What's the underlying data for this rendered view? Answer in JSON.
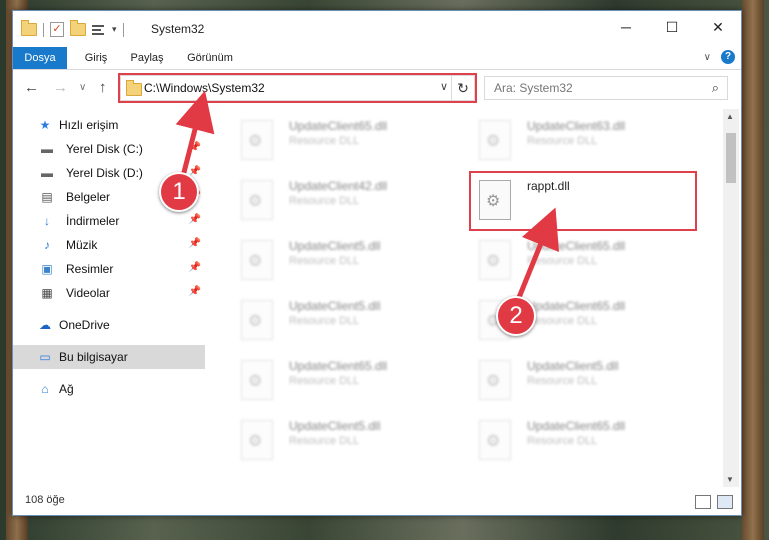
{
  "window": {
    "title": "System32",
    "controls": {
      "minimize": "─",
      "maximize": "☐",
      "close": "✕"
    }
  },
  "ribbon": {
    "tabs": [
      "Dosya",
      "Giriş",
      "Paylaş",
      "Görünüm"
    ],
    "collapse": "∨",
    "help": "?"
  },
  "nav": {
    "back": "←",
    "forward": "→",
    "recent": "∨",
    "up": "↑",
    "address": "C:\\Windows\\System32",
    "address_dropdown": "∨",
    "refresh": "↻",
    "search_placeholder": "Ara: System32",
    "search_icon": "⌕"
  },
  "sidebar": {
    "items": [
      {
        "label": "Hızlı erişim",
        "icon": "★"
      },
      {
        "label": "Yerel Disk (C:)",
        "icon": "▬"
      },
      {
        "label": "Yerel Disk (D:)",
        "icon": "▬"
      },
      {
        "label": "Belgeler",
        "icon": "▤"
      },
      {
        "label": "İndirmeler",
        "icon": "↓"
      },
      {
        "label": "Müzik",
        "icon": "♪"
      },
      {
        "label": "Resimler",
        "icon": "▣"
      },
      {
        "label": "Videolar",
        "icon": "▦"
      },
      {
        "label": "OneDrive",
        "icon": "☁"
      },
      {
        "label": "Bu bilgisayar",
        "icon": "▭"
      },
      {
        "label": "Ağ",
        "icon": "⌂"
      }
    ],
    "pin": "📌"
  },
  "files": [
    {
      "name": "UpdateClient65.dll",
      "desc": "Resource DLL"
    },
    {
      "name": "UpdateClient63.dll",
      "desc": "Resource DLL"
    },
    {
      "name": "UpdateClient42.dll",
      "desc": "Resource DLL"
    },
    {
      "name": "rappt.dll",
      "desc": ""
    },
    {
      "name": "UpdateClient5.dll",
      "desc": "Resource DLL"
    },
    {
      "name": "UpdateClient65.dll",
      "desc": "Resource DLL"
    },
    {
      "name": "UpdateClient5.dll",
      "desc": "Resource DLL"
    },
    {
      "name": "UpdateClient65.dll",
      "desc": "Resource DLL"
    },
    {
      "name": "UpdateClient65.dll",
      "desc": "Resource DLL"
    },
    {
      "name": "UpdateClient5.dll",
      "desc": "Resource DLL"
    },
    {
      "name": "UpdateClient5.dll",
      "desc": "Resource DLL"
    },
    {
      "name": "UpdateClient65.dll",
      "desc": "Resource DLL"
    }
  ],
  "status": {
    "count": "108 öğe"
  },
  "annotations": {
    "step1": "1",
    "step2": "2",
    "color": "#e23a44"
  }
}
